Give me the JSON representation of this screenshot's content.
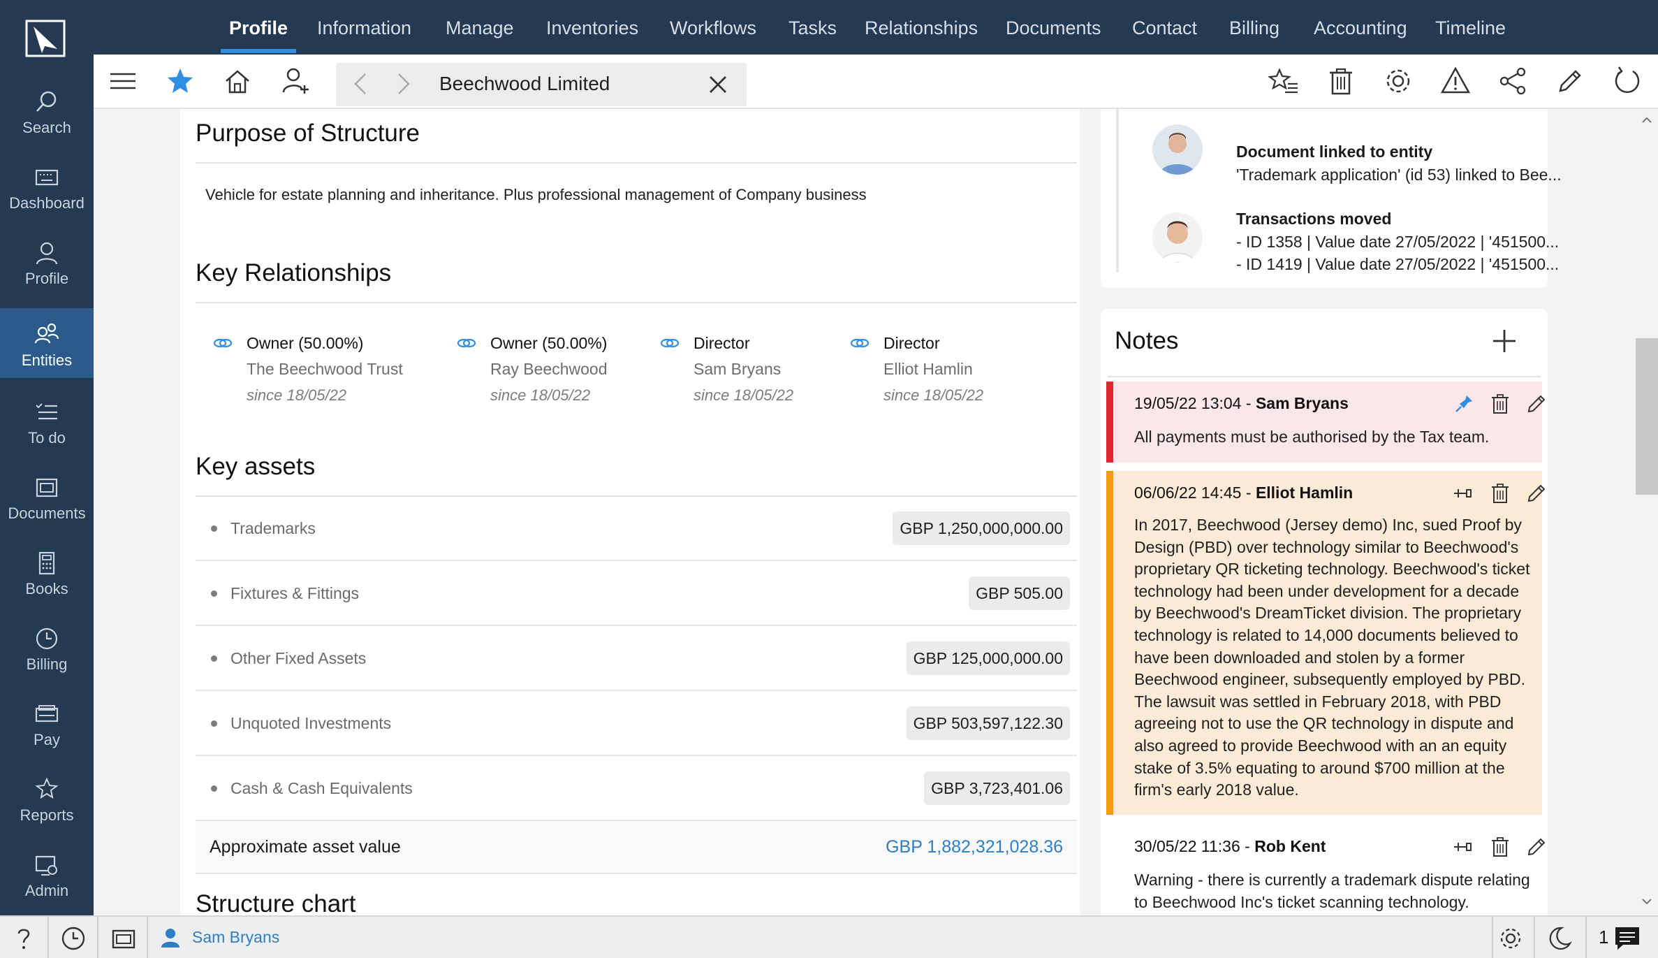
{
  "sidebar": {
    "items": [
      {
        "label": "Search",
        "icon": "search-icon"
      },
      {
        "label": "Dashboard",
        "icon": "keyboard-icon"
      },
      {
        "label": "Profile",
        "icon": "person-icon"
      },
      {
        "label": "Entities",
        "icon": "entities-icon",
        "active": true
      },
      {
        "label": "To do",
        "icon": "checklist-icon"
      },
      {
        "label": "Documents",
        "icon": "documents-icon"
      },
      {
        "label": "Books",
        "icon": "calculator-icon"
      },
      {
        "label": "Billing",
        "icon": "clock-icon"
      },
      {
        "label": "Pay",
        "icon": "payment-icon"
      },
      {
        "label": "Reports",
        "icon": "star-list-icon"
      },
      {
        "label": "Admin",
        "icon": "admin-icon"
      }
    ]
  },
  "topnav": {
    "tabs": [
      "Profile",
      "Information",
      "Manage",
      "Inventories",
      "Workflows",
      "Tasks",
      "Relationships",
      "Documents",
      "Contact",
      "Billing",
      "Accounting",
      "Timeline"
    ],
    "active": "Profile"
  },
  "toolbar": {
    "entity_title": "Beechwood Limited"
  },
  "main": {
    "purpose_title": "Purpose of Structure",
    "purpose_text": "Vehicle for estate planning and inheritance. Plus professional management of Company business",
    "relationships_title": "Key Relationships",
    "relationships": [
      {
        "role": "Owner (50.00%)",
        "name": "The Beechwood Trust",
        "since": "since 18/05/22"
      },
      {
        "role": "Owner (50.00%)",
        "name": "Ray Beechwood",
        "since": "since 18/05/22"
      },
      {
        "role": "Director",
        "name": "Sam Bryans",
        "since": "since 18/05/22"
      },
      {
        "role": "Director",
        "name": "Elliot Hamlin",
        "since": "since 18/05/22"
      }
    ],
    "assets_title": "Key assets",
    "assets": [
      {
        "name": "Trademarks",
        "value": "GBP 1,250,000,000.00"
      },
      {
        "name": "Fixtures & Fittings",
        "value": "GBP 505.00"
      },
      {
        "name": "Other Fixed Assets",
        "value": "GBP 125,000,000.00"
      },
      {
        "name": "Unquoted Investments",
        "value": "GBP 503,597,122.30"
      },
      {
        "name": "Cash & Cash Equivalents",
        "value": "GBP 3,723,401.06"
      }
    ],
    "approx_label": "Approximate asset value",
    "approx_value": "GBP 1,882,321,028.36",
    "structure_title": "Structure chart"
  },
  "activity": [
    {
      "title": "Document linked to entity",
      "lines": [
        "'Trademark application' (id 53) linked to Bee..."
      ]
    },
    {
      "title": "Transactions moved",
      "lines": [
        "- ID  1358 | Value date 27/05/2022 | '451500...",
        "- ID  1419 | Value date 27/05/2022 | '451500..."
      ]
    }
  ],
  "notes": {
    "title": "Notes",
    "items": [
      {
        "date": "19/05/22 13:04",
        "sep": " - ",
        "author": "Sam Bryans",
        "body": "All payments must be authorised by the Tax team.",
        "pinned": true
      },
      {
        "date": "06/06/22 14:45",
        "sep": " - ",
        "author": "Elliot Hamlin",
        "body": "In 2017, Beechwood (Jersey demo) Inc, sued Proof by Design (PBD) over technology similar to Beechwood's proprietary QR ticketing technology. Beechwood's ticket technology had been under development for a decade by Beechwood's DreamTicket division. The proprietary technology is related to 14,000 documents believed to have been downloaded and stolen by a former Beechwood engineer, subsequently employed by PBD. The lawsuit was settled in February 2018, with PBD agreeing not to use the QR technology in dispute and also agreed to provide Beechwood with an an equity stake of 3.5% equating to around $700 million at the firm's early 2018 value.",
        "pinned": false
      },
      {
        "date": "30/05/22 11:36",
        "sep": " - ",
        "author": "Rob Kent",
        "body": "Warning - there is currently a trademark dispute relating to Beechwood Inc's ticket scanning technology.",
        "pinned": false
      }
    ]
  },
  "statusbar": {
    "user": "Sam Bryans",
    "count": "1"
  },
  "colors": {
    "nav_bg": "#243a52",
    "active_blue": "#2f8fe0",
    "link_blue": "#2d7fc4",
    "note_red": "#e0262f",
    "note_orange": "#f39c12"
  }
}
